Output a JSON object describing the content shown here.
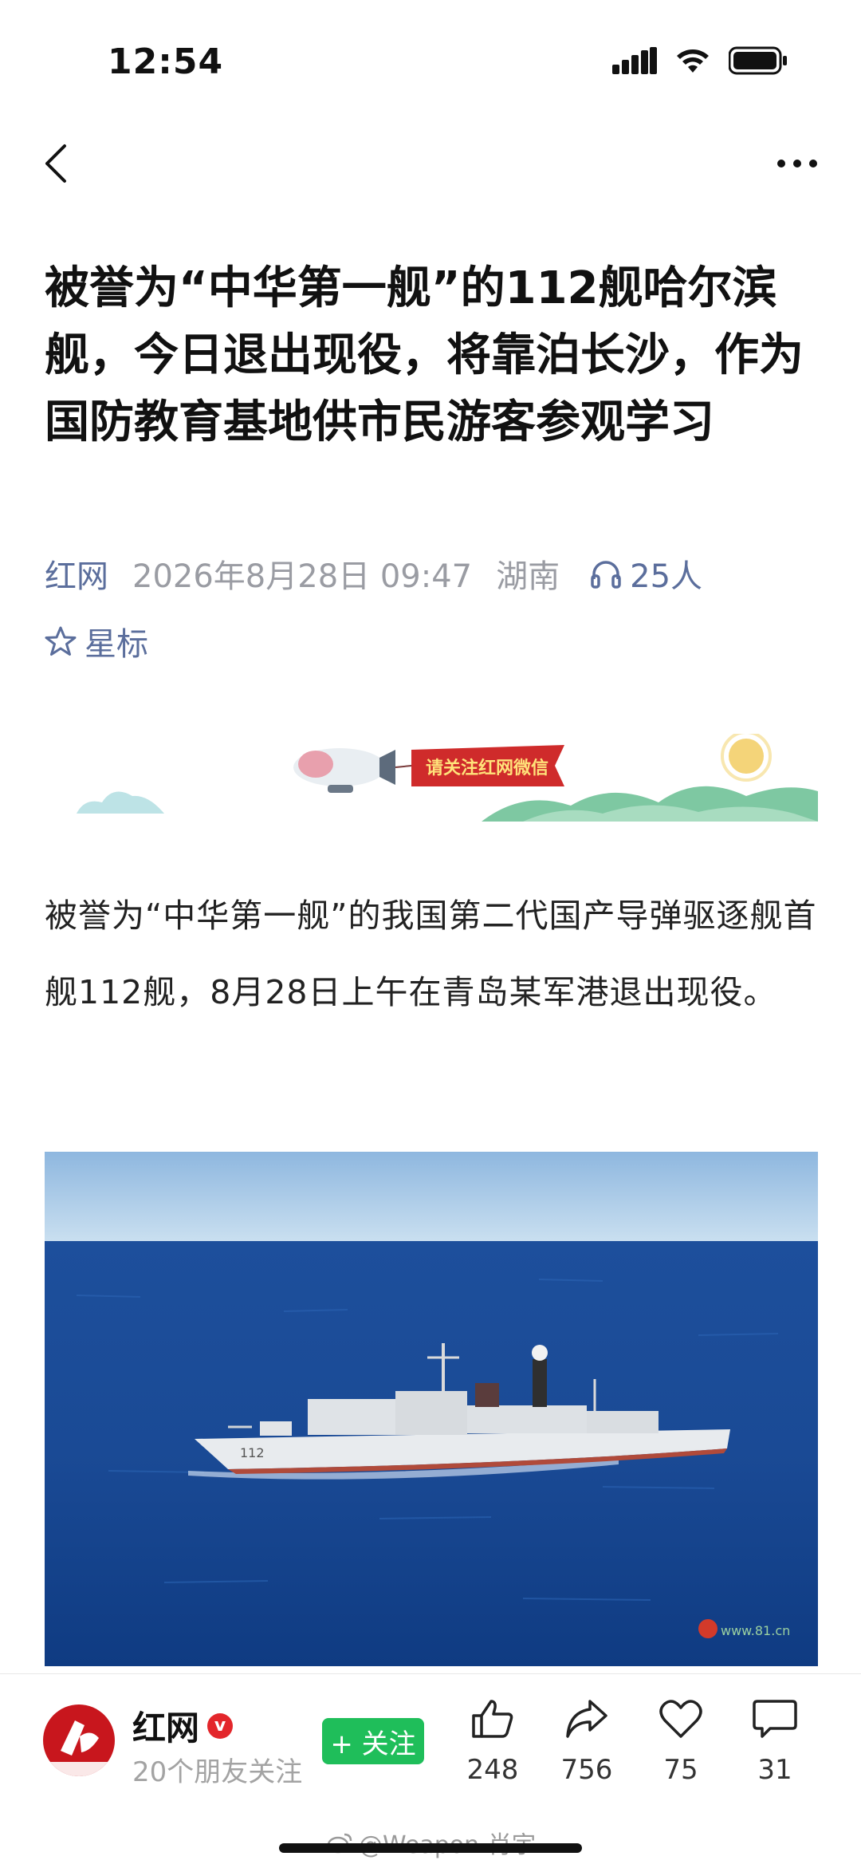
{
  "status": {
    "time": "12:54"
  },
  "article": {
    "title": "被誉为“中华第一舰”的112舰哈尔滨舰，今日退出现役，将靠泊长沙，作为国防教育基地供市民游客参观学习",
    "source": "红网",
    "date": "2026年8月28日 09:47",
    "region": "湖南",
    "listeners": "25人",
    "star_label": "星标",
    "banner_text": "请关注红网微信",
    "body": "被誉为“中华第一舰”的我国第二代国产导弹驱逐舰首舰112舰，8月28日上午在青岛某军港退出现役。",
    "photo": {
      "hull_number": "112",
      "watermark": "www.81.cn"
    }
  },
  "bottom_bar": {
    "author_name": "红网",
    "verified_badge": "v",
    "friends_following": "20个朋友关注",
    "follow_label": "+ 关注",
    "likes": "248",
    "shares": "756",
    "favorites": "75",
    "comments": "31"
  },
  "overlay": {
    "watermark": "@Weapon-肖宇"
  },
  "colors": {
    "accent_blue": "#5b6e9c",
    "follow_green": "#1fbe5a",
    "brand_red": "#c8161d"
  }
}
